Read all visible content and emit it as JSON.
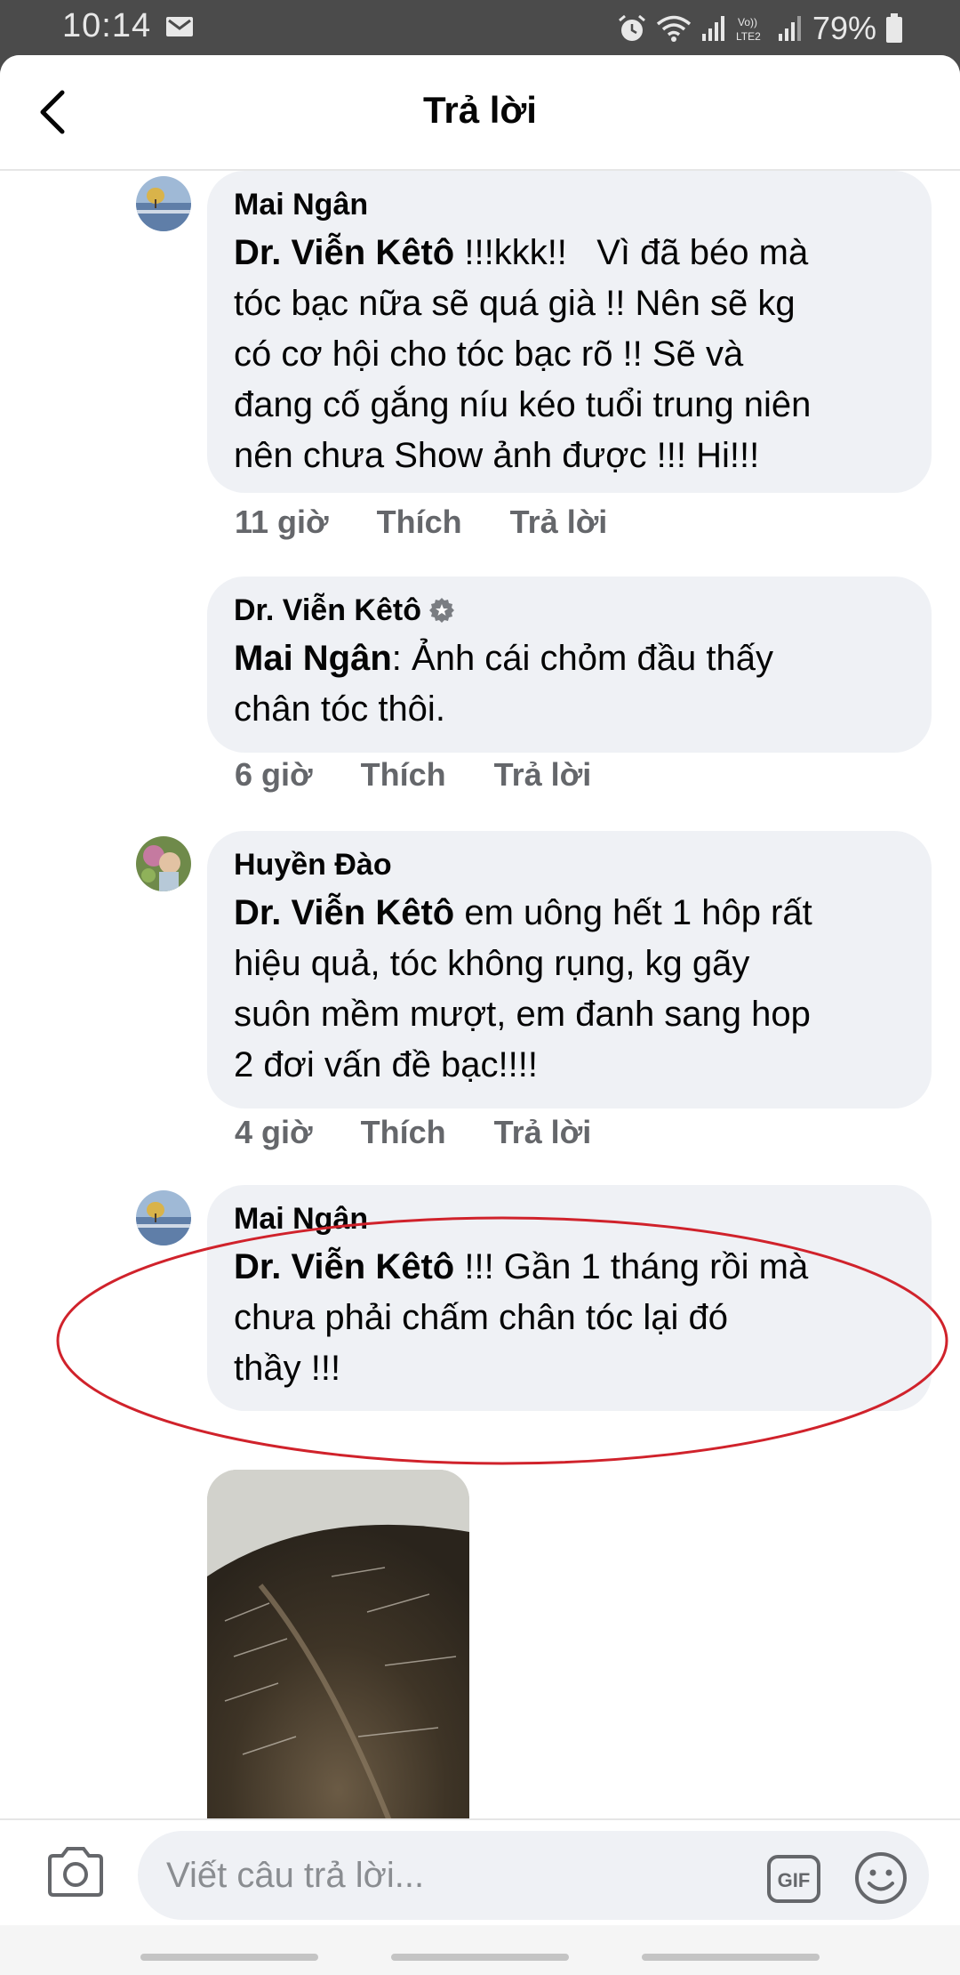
{
  "status_bar": {
    "time": "10:14",
    "battery": "79%"
  },
  "header": {
    "title": "Trả lời",
    "back_icon": "chevron-left-icon"
  },
  "comments": [
    {
      "author": "Mai Ngân",
      "mention": "Dr. Viễn Kêtô",
      "lines": [
        " !!!kkk!!   Vì đã béo mà",
        "tóc bạc nữa sẽ quá già !!  Nên sẽ kg",
        "có cơ hội cho tóc bạc rõ !! Sẽ và",
        "đang cố gắng níu kéo tuổi trung niên",
        "nên chưa Show ảnh được !!! Hi!!!"
      ],
      "time": "11 giờ",
      "like": "Thích",
      "reply": "Trả lời"
    },
    {
      "author": "Dr. Viễn Kêtô",
      "verified_icon": "verified-badge-icon",
      "mention": "Mai Ngân",
      "lines": [
        ": Ảnh cái chỏm đầu thấy",
        "chân tóc thôi."
      ],
      "time": "6 giờ",
      "like": "Thích",
      "reply": "Trả lời"
    },
    {
      "author": "Huyền Đào",
      "mention": "Dr. Viễn Kêtô",
      "lines": [
        " em uông hết 1 hôp rất",
        "hiệu quả, tóc không rụng, kg gãy",
        "suôn mềm mượt, em đanh sang hop",
        "2 đơi vấn đề bạc!!!!"
      ],
      "time": "4 giờ",
      "like": "Thích",
      "reply": "Trả lời"
    },
    {
      "author": "Mai Ngân",
      "mention": "Dr. Viễn Kêtô",
      "lines": [
        " !!! Gần 1 tháng rồi mà",
        "chưa phải chấm chân tóc lại đó",
        "thầy !!!"
      ]
    }
  ],
  "annotation": {
    "color": "#d0222b"
  },
  "composer": {
    "placeholder": "Viết câu trả lời...",
    "gif_label": "GIF",
    "camera_icon": "camera-icon",
    "emoji_icon": "emoji-icon"
  },
  "colors": {
    "bubble": "#eff1f5",
    "meta_text": "#65676b",
    "status_bar": "#4b4b4b"
  }
}
